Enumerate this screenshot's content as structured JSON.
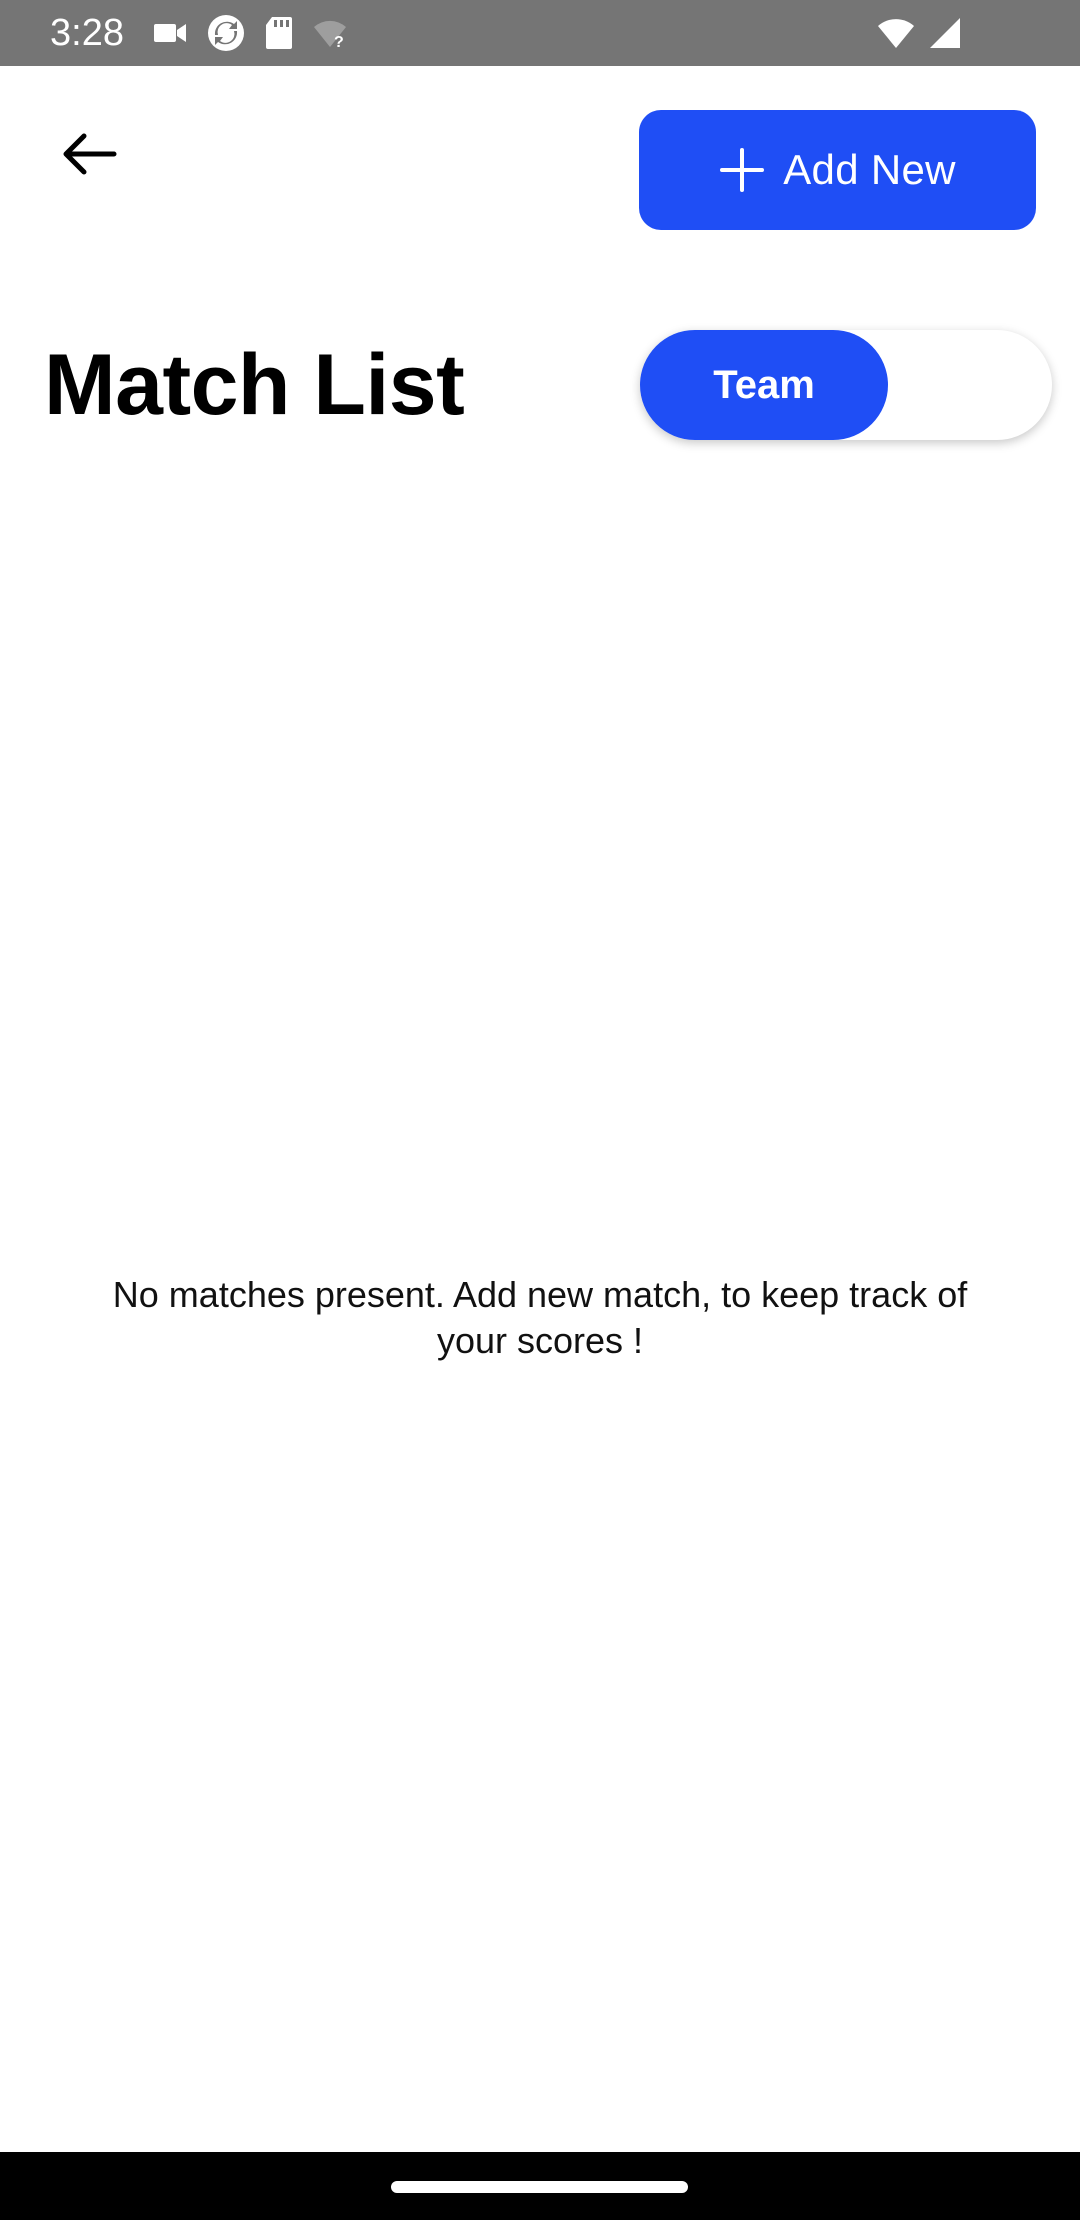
{
  "status_bar": {
    "time": "3:28",
    "left_icons": [
      "video-camera-icon",
      "sync-app-icon",
      "sd-card-icon",
      "wifi-question-icon"
    ],
    "right_icons": [
      "wifi-icon",
      "cell-signal-icon"
    ]
  },
  "header": {
    "back_icon": "arrow-left-icon",
    "add_new_label": "Add New",
    "add_new_icon": "plus-icon"
  },
  "title": "Match List",
  "toggle": {
    "selected_label": "Team",
    "unselected_label": ""
  },
  "empty_state": {
    "message": "No matches present. Add new match, to keep track of your scores !"
  },
  "colors": {
    "accent": "#1f4ef5",
    "status_bar": "#757575",
    "nav_bar": "#000000"
  }
}
